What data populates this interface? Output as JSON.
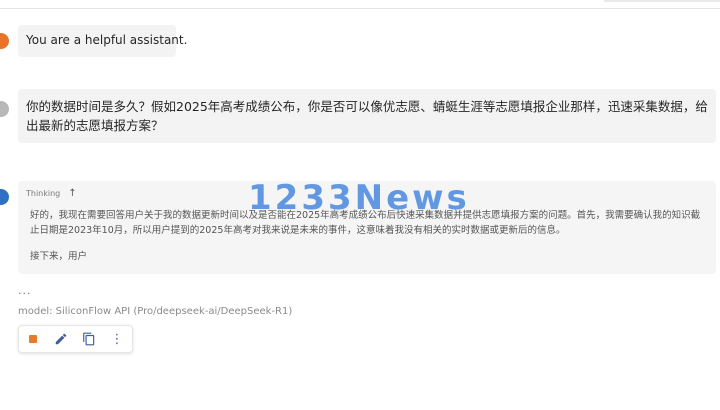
{
  "system_message": {
    "text": "You are a helpful assistant."
  },
  "user_message": {
    "text": "你的数据时间是多久？假如2025年高考成绩公布，你是否可以像优志愿、蜻蜓生涯等志愿填报企业那样，迅速采集数据，给出最新的志愿填报方案？"
  },
  "assistant": {
    "thinking_label": "Thinking",
    "thinking_toggle_icon": "arrow-up-icon",
    "thinking_text_1": "好的，我现在需要回答用户关于我的数据更新时间以及是否能在2025年高考成绩公布后快速采集数据并提供志愿填报方案的问题。首先，我需要确认我的知识截止日期是2023年10月，所以用户提到的2025年高考对我来说是未来的事件，这意味着我没有相关的实时数据或更新后的信息。",
    "thinking_text_2": "接下来，用户",
    "ellipsis": "...",
    "model_info": "model: SiliconFlow API (Pro/deepseek-ai/DeepSeek-R1)"
  },
  "watermark": {
    "text": "1233News"
  },
  "actions": [
    {
      "name": "stop-icon"
    },
    {
      "name": "edit-icon"
    },
    {
      "name": "copy-icon"
    },
    {
      "name": "more-vert-icon"
    }
  ],
  "colors": {
    "system_avatar": "#e8742a",
    "user_avatar": "#b8b8b8",
    "bot_avatar": "#2f6fc4",
    "stop": "#e77b28",
    "icon_blue": "#3d5d9c",
    "watermark": "#387cdc"
  }
}
